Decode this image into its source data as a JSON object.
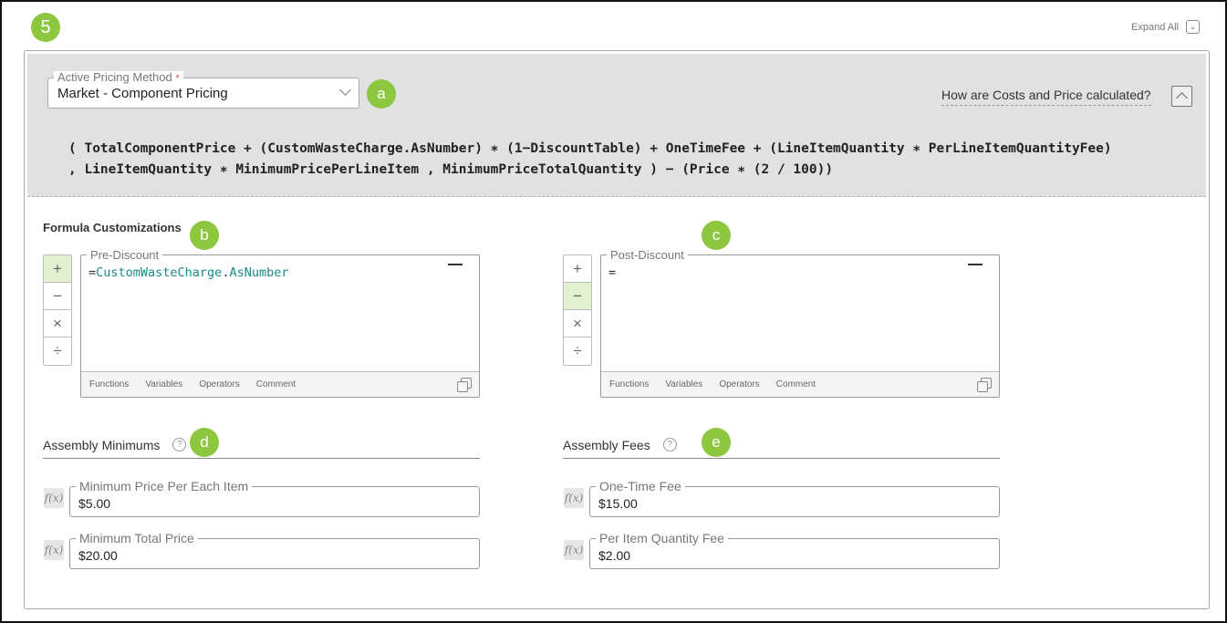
{
  "step_number": "5",
  "expand_all_label": "Expand All",
  "pricing": {
    "label": "Active Pricing Method",
    "required_mark": "*",
    "value": "Market - Component Pricing",
    "help_link": "How are Costs and Price calculated?",
    "formula_line1": "( TotalComponentPrice + (CustomWasteCharge.AsNumber) ∗ (1−DiscountTable) + OneTimeFee + (LineItemQuantity ∗ PerLineItemQuantityFee)",
    "formula_line2": ", LineItemQuantity ∗ MinimumPricePerLineItem , MinimumPriceTotalQuantity ) − (Price ∗ (2 / 100))"
  },
  "markers": {
    "a": "a",
    "b": "b",
    "c": "c",
    "d": "d",
    "e": "e"
  },
  "customizations": {
    "title": "Formula Customizations",
    "operators": [
      "+",
      "−",
      "×",
      "÷"
    ],
    "pre_discount": {
      "label": "Pre-Discount",
      "prefix": "=",
      "token1": "CustomWasteCharge",
      "dot": ".",
      "token2": "AsNumber"
    },
    "post_discount": {
      "label": "Post-Discount",
      "prefix": "="
    },
    "toolbar": [
      "Functions",
      "Variables",
      "Operators",
      "Comment"
    ]
  },
  "assembly_minimums": {
    "title": "Assembly Minimums",
    "help": "?",
    "fx": "f(x)",
    "fields": [
      {
        "label": "Minimum Price Per Each Item",
        "value": "$5.00"
      },
      {
        "label": "Minimum Total Price",
        "value": "$20.00"
      }
    ]
  },
  "assembly_fees": {
    "title": "Assembly Fees",
    "help": "?",
    "fx": "f(x)",
    "fields": [
      {
        "label": "One-Time Fee",
        "value": "$15.00"
      },
      {
        "label": "Per Item Quantity Fee",
        "value": "$2.00"
      }
    ]
  },
  "colors": {
    "accent_green": "#8dc63f",
    "panel_gray": "#e1e1e1",
    "token_teal": "#1b8a8a"
  }
}
